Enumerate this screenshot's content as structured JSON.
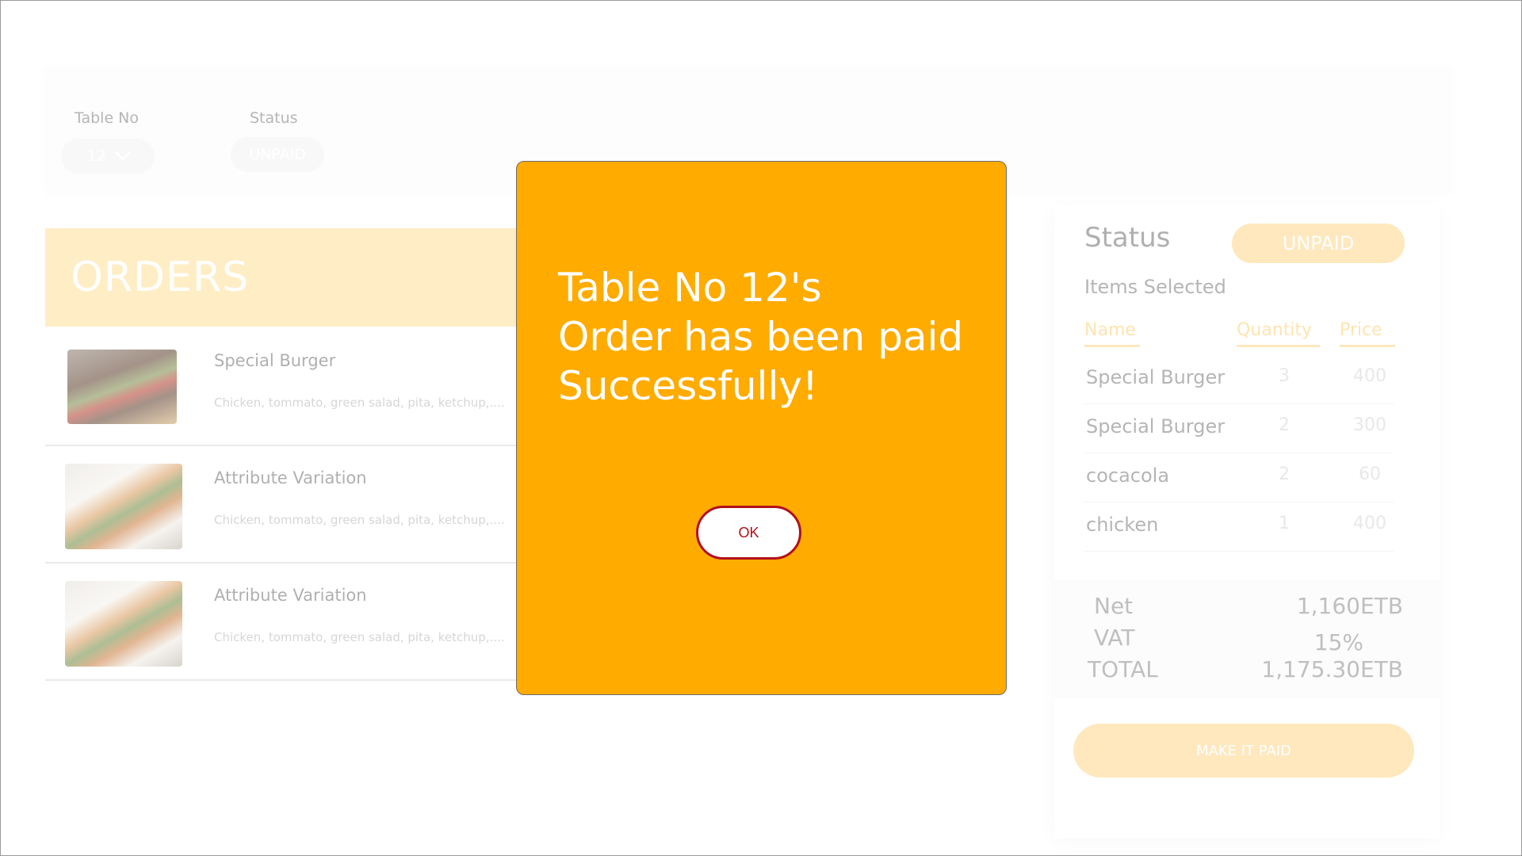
{
  "filters": {
    "table_label": "Table No",
    "table_value": "12",
    "status_label": "Status",
    "status_value": "UNPAID"
  },
  "orders": {
    "title": "ORDERS",
    "items": [
      {
        "name": "Special Burger",
        "description": "Chicken, tommato, green salad, pita, ketchup,....",
        "image": "burger"
      },
      {
        "name": "Attribute Variation",
        "description": "Chicken, tommato, green salad, pita, ketchup,....",
        "image": "wrap"
      },
      {
        "name": "Attribute Variation",
        "description": "Chicken, tommato, green salad, pita, ketchup,....",
        "image": "wrap"
      }
    ]
  },
  "summary": {
    "status_label": "Status",
    "status_badge": "UNPAID",
    "items_selected_label": "Items Selected",
    "columns": {
      "name": "Name",
      "quantity": "Quantity",
      "price": "Price"
    },
    "rows": [
      {
        "name": "Special Burger",
        "quantity": "3",
        "price": "400"
      },
      {
        "name": "Special Burger",
        "quantity": "2",
        "price": "300"
      },
      {
        "name": "cocacola",
        "quantity": "2",
        "price": "60"
      },
      {
        "name": "chicken",
        "quantity": "1",
        "price": "400"
      }
    ],
    "net_label": "Net",
    "net_value": "1,160ETB",
    "vat_label": "VAT",
    "vat_value": "15%",
    "total_label": "TOTAL",
    "total_value": "1,175.30ETB",
    "make_paid_label": "MAKE IT PAID"
  },
  "modal": {
    "line1": "Table No 12's",
    "line2": "Order has been paid",
    "line3": "Successfully!",
    "ok_label": "OK"
  },
  "colors": {
    "accent": "#ffab00",
    "accent_light": "#ffd78a",
    "ok_border": "#b1101a"
  }
}
